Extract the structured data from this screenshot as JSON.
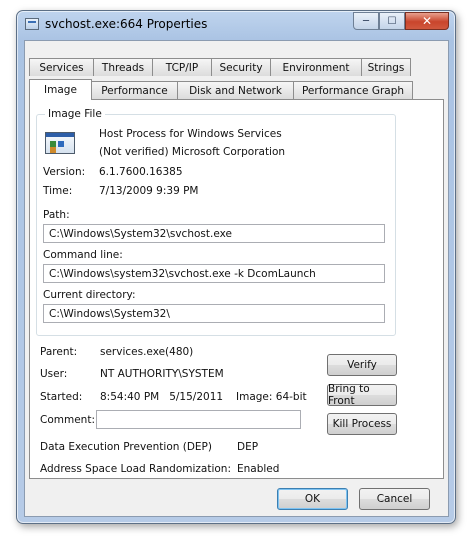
{
  "window": {
    "title": "svchost.exe:664 Properties"
  },
  "caption": {
    "minimize": "─",
    "maximize": "☐",
    "close": "✕"
  },
  "tabs_back": [
    "Services",
    "Threads",
    "TCP/IP",
    "Security",
    "Environment",
    "Strings"
  ],
  "tabs_front": [
    "Image",
    "Performance",
    "Disk and Network",
    "Performance Graph"
  ],
  "active_tab": "Image",
  "image_file": {
    "legend": "Image File",
    "description": "Host Process for Windows Services",
    "company": "(Not verified) Microsoft Corporation",
    "version_label": "Version:",
    "version_value": "6.1.7600.16385",
    "time_label": "Time:",
    "time_value": "7/13/2009 9:39 PM",
    "path_label": "Path:",
    "path_value": "C:\\Windows\\System32\\svchost.exe",
    "command_line_label": "Command line:",
    "command_line_value": "C:\\Windows\\system32\\svchost.exe -k DcomLaunch",
    "current_dir_label": "Current directory:",
    "current_dir_value": "C:\\Windows\\System32\\"
  },
  "details": {
    "parent_label": "Parent:",
    "parent_value": "services.exe(480)",
    "user_label": "User:",
    "user_value": "NT AUTHORITY\\SYSTEM",
    "started_label": "Started:",
    "started_value": "8:54:40 PM   5/15/2011",
    "image_bits": "Image: 64-bit",
    "comment_label": "Comment:",
    "comment_value": "",
    "dep_label": "Data Execution Prevention (DEP)",
    "dep_value": "DEP",
    "aslr_label": "Address Space Load Randomization:",
    "aslr_value": "Enabled"
  },
  "buttons": {
    "verify": "Verify",
    "bring_to_front": "Bring to Front",
    "kill_process": "Kill Process",
    "ok": "OK",
    "cancel": "Cancel"
  }
}
